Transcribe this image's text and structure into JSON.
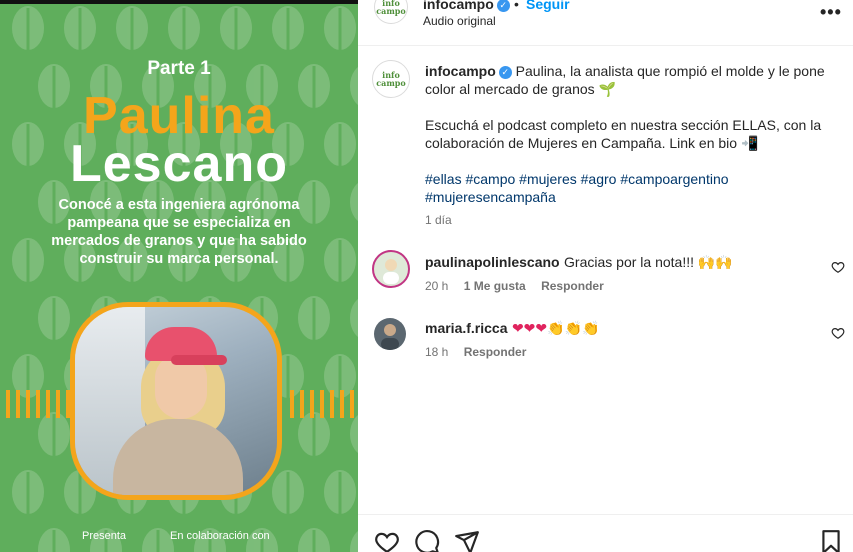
{
  "media": {
    "part": "Parte 1",
    "first_name": "Paulina",
    "last_name": "Lescano",
    "description": "Conocé a esta ingeniera agrónoma pampeana que se especializa en mercados de granos y que ha sabido construir su marca personal.",
    "presenta": "Presenta",
    "colaboracion": "En colaboración con"
  },
  "header": {
    "username": "infocampo",
    "dot": "•",
    "follow_label": "Seguir",
    "audio": "Audio original",
    "more": "•••",
    "logo_text": "info campo"
  },
  "caption": {
    "username": "infocampo",
    "text": "Paulina, la analista que rompió el molde y le pone color al mercado de granos 🌱",
    "text2": "Escuchá el podcast completo en nuestra sección ELLAS, con la colaboración de Mujeres en Campaña. Link en bio 📲",
    "hashtags": "#ellas #campo #mujeres #agro #campoargentino #mujeresencampaña",
    "time": "1 día"
  },
  "comments": [
    {
      "username": "paulinapolinlescano",
      "text": "Gracias por la nota!!! 🙌🙌",
      "time": "20 h",
      "likes": "1 Me gusta",
      "reply": "Responder"
    },
    {
      "username": "maria.f.ricca",
      "text": "❤❤❤👏👏👏",
      "time": "18 h",
      "reply": "Responder"
    }
  ],
  "colors": {
    "green_bg": "#5fae5c",
    "orange_accent": "#f4a51b",
    "link_blue": "#0095f6",
    "hashtag_blue": "#00376b"
  },
  "icons": [
    "heart-icon",
    "comment-icon",
    "share-icon",
    "bookmark-icon",
    "verified-icon",
    "more-icon"
  ]
}
